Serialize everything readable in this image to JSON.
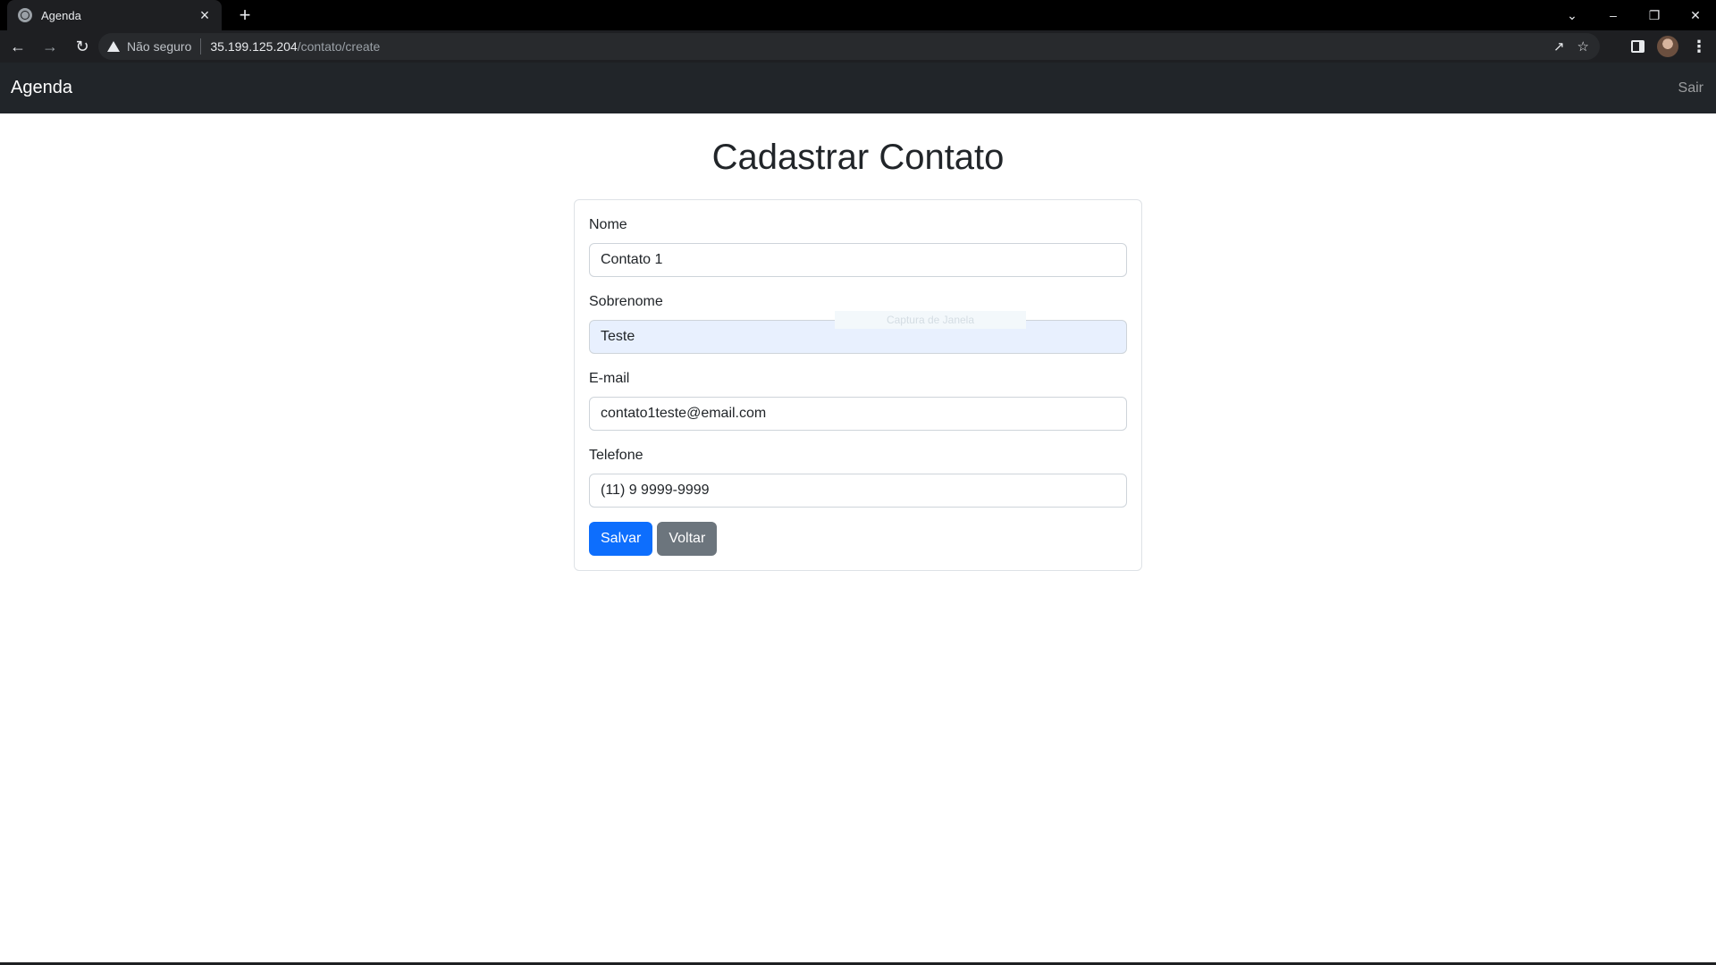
{
  "browser": {
    "tab_title": "Agenda",
    "tab_close": "×",
    "new_tab": "+",
    "security_label": "Não seguro",
    "url_host": "35.199.125.204",
    "url_path": "/contato/create",
    "icons": {
      "back": "arrow-left-icon",
      "forward": "arrow-right-icon",
      "reload": "reload-icon",
      "warning": "warning-icon",
      "share": "share-icon",
      "bookmark": "star-icon",
      "side_panel": "side-panel-icon",
      "profile": "avatar",
      "menu": "kebab-menu-icon",
      "tab_search": "chevron-down-icon",
      "minimize": "minimize-icon",
      "restore": "restore-icon",
      "close": "close-icon"
    }
  },
  "navbar": {
    "brand": "Agenda",
    "logout": "Sair",
    "background": "#212529"
  },
  "page": {
    "title": "Cadastrar Contato"
  },
  "form": {
    "fields": [
      {
        "label": "Nome",
        "value": "Contato 1"
      },
      {
        "label": "Sobrenome",
        "value": "Teste"
      },
      {
        "label": "E-mail",
        "value": "contato1teste@email.com"
      },
      {
        "label": "Telefone",
        "value": "(11) 9 9999-9999"
      }
    ],
    "save_label": "Salvar",
    "back_label": "Voltar",
    "colors": {
      "primary": "#0d6efd",
      "secondary": "#6c757d",
      "autofill": "#e8f0fe"
    }
  },
  "overlay_hint": "Captura de Janela"
}
